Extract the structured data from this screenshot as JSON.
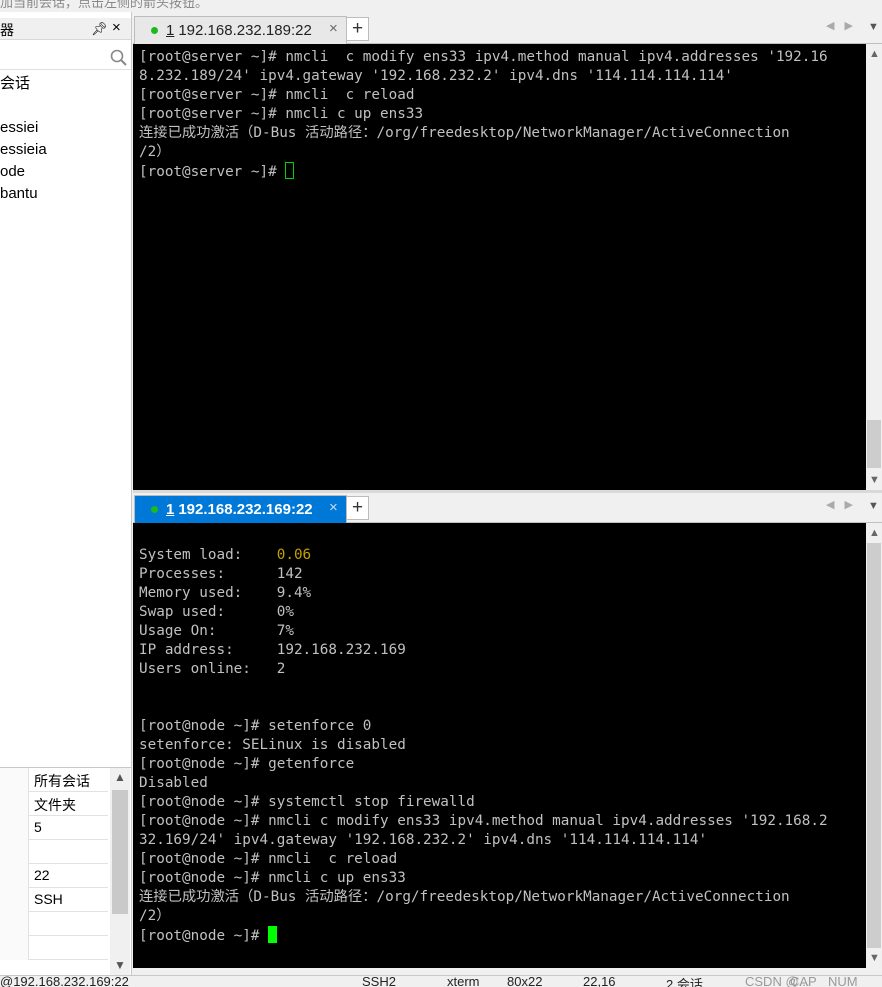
{
  "app": {
    "hint_text": "加当前会话，点击左侧的箭头按钮。"
  },
  "session_panel": {
    "title": "器",
    "pin_icon": "pin-icon",
    "close_glyph": "×",
    "search_icon": "search-icon",
    "tree_items": [
      "会话",
      "essiei",
      "essieia",
      "ode",
      "bantu"
    ]
  },
  "properties": {
    "rows": [
      {
        "value": "所有会话"
      },
      {
        "value": "文件夹"
      },
      {
        "value": "5"
      },
      {
        "value": ""
      },
      {
        "value": "22"
      },
      {
        "value": "SSH"
      },
      {
        "value": ""
      },
      {
        "value": ""
      }
    ]
  },
  "pane_top": {
    "tab": {
      "index": "1",
      "host": "192.168.232.189:22",
      "close": "×"
    },
    "add_tab": "+",
    "lines": [
      "[root@server ~]# nmcli  c modify ens33 ipv4.method manual ipv4.addresses '192.16",
      "8.232.189/24' ipv4.gateway '192.168.232.2' ipv4.dns '114.114.114.114'",
      "[root@server ~]# nmcli  c reload",
      "[root@server ~]# nmcli c up ens33",
      "连接已成功激活（D-Bus 活动路径：/org/freedesktop/NetworkManager/ActiveConnection",
      "/2）"
    ],
    "prompt": "[root@server ~]# "
  },
  "pane_bottom": {
    "tab": {
      "index": "1",
      "host": "192.168.232.169:22",
      "close": "×"
    },
    "add_tab": "+",
    "stats": [
      {
        "label": "System load:    ",
        "value": "0.06",
        "highlight": true
      },
      {
        "label": "Processes:      ",
        "value": "142"
      },
      {
        "label": "Memory used:    ",
        "value": "9.4%"
      },
      {
        "label": "Swap used:      ",
        "value": "0%"
      },
      {
        "label": "Usage On:       ",
        "value": "7%"
      },
      {
        "label": "IP address:     ",
        "value": "192.168.232.169"
      },
      {
        "label": "Users online:   ",
        "value": "2"
      }
    ],
    "lines": [
      "[root@node ~]# setenforce 0",
      "setenforce: SELinux is disabled",
      "[root@node ~]# getenforce",
      "Disabled",
      "[root@node ~]# systemctl stop firewalld",
      "[root@node ~]# nmcli c modify ens33 ipv4.method manual ipv4.addresses '192.168.2",
      "32.169/24' ipv4.gateway '192.168.232.2' ipv4.dns '114.114.114.114'",
      "[root@node ~]# nmcli  c reload",
      "[root@node ~]# nmcli c up ens33",
      "连接已成功激活（D-Bus 活动路径：/org/freedesktop/NetworkManager/ActiveConnection",
      "/2）"
    ],
    "prompt": "[root@node ~]# "
  },
  "status_bar": {
    "host": "@192.168.232.169:22",
    "protocol": "SSH2",
    "terminal": "xterm",
    "size": "80x22",
    "cursor": "22,16",
    "sessions": "2 会话",
    "cap": "CAP",
    "num": "NUM",
    "watermark": "CSDN @..."
  }
}
